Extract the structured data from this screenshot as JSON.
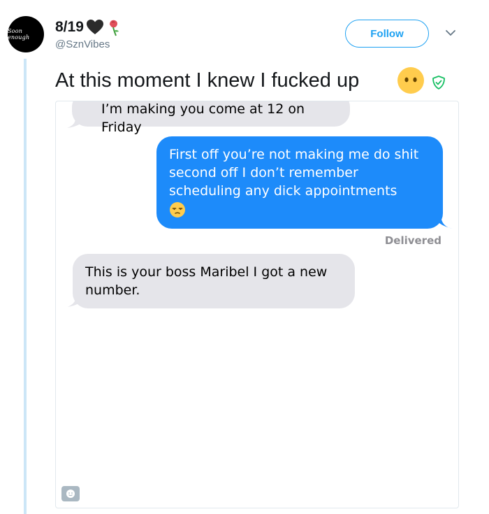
{
  "user": {
    "display_name": "8/19",
    "handle": "@SznVibes",
    "avatar_text": "Soon enough"
  },
  "actions": {
    "follow_label": "Follow"
  },
  "tweet": {
    "text": "At this moment I knew I fucked up"
  },
  "messages": [
    {
      "side": "received",
      "text": "I’m making you come at 12 on Friday"
    },
    {
      "side": "sent",
      "text_lines": [
        "First off you’re not making me do shit",
        "second off I don’t remember",
        "scheduling any dick appointments"
      ]
    },
    {
      "side": "received",
      "text_lines": [
        "This is your boss Maribel I got a new",
        "number."
      ]
    }
  ],
  "status": {
    "delivered": "Delivered"
  },
  "icons": {
    "heart": "black-heart-icon",
    "rose": "wilted-rose-icon",
    "tweet_emoji": "face-without-mouth-emoji",
    "verified_shield": "shield-check-icon",
    "message_emoji": "unamused-face-emoji",
    "chevron": "chevron-down-icon"
  },
  "colors": {
    "accent": "#1da1f2",
    "sent_bubble": "#1d8bfa",
    "received_bubble": "#e5e5ea",
    "shield": "#17bf63",
    "thread_line": "#cce6f7"
  }
}
